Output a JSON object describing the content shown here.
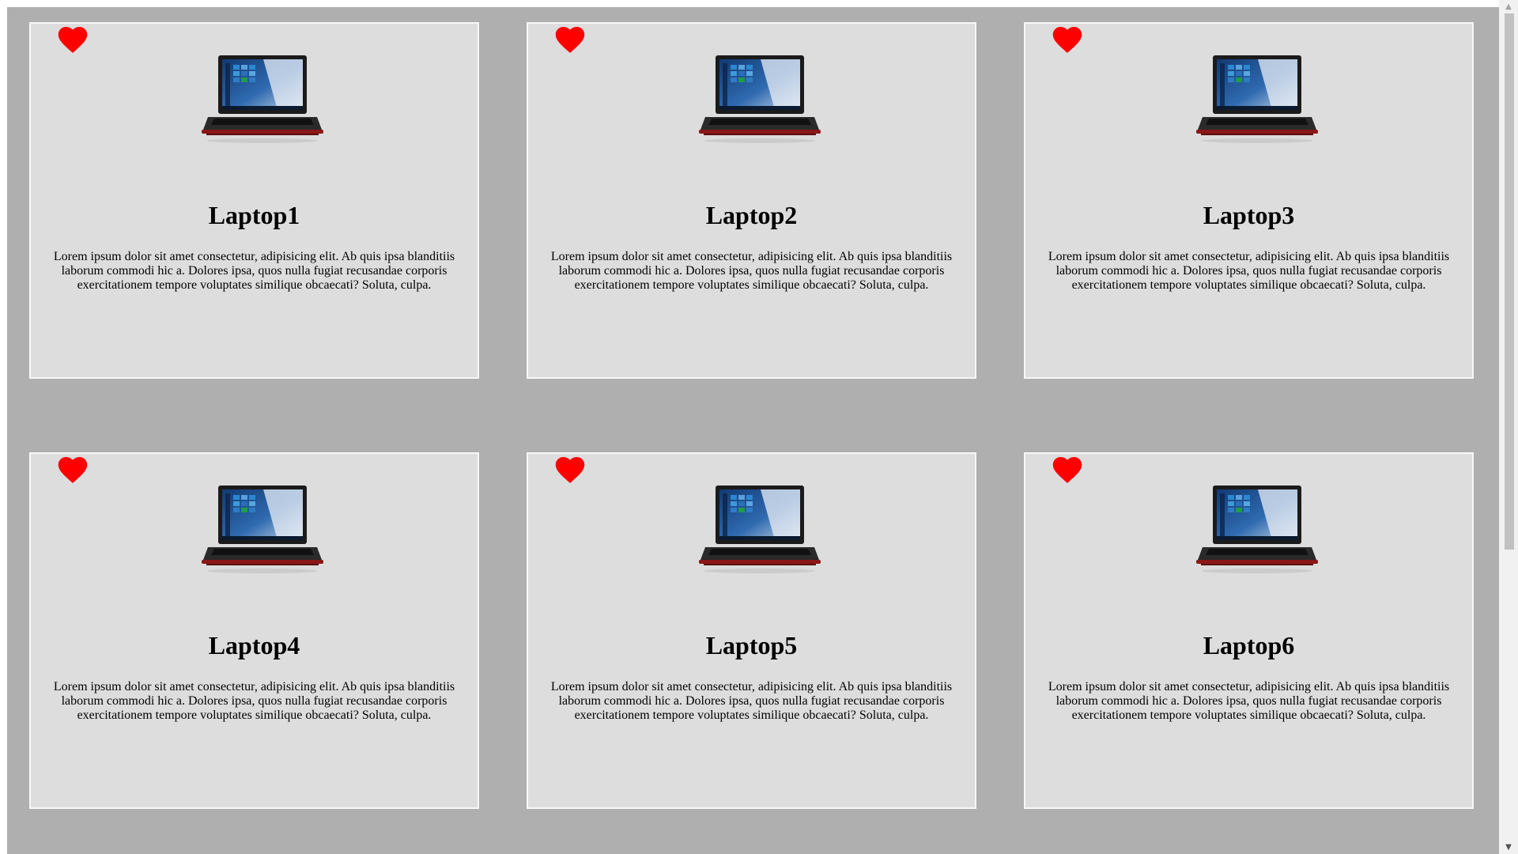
{
  "cards": [
    {
      "title": "Laptop1",
      "description": "Lorem ipsum dolor sit amet consectetur, adipisicing elit. Ab quis ipsa blanditiis laborum commodi hic a. Dolores ipsa, quos nulla fugiat recusandae corporis exercitationem tempore voluptates similique obcaecati? Soluta, culpa.",
      "favorite_icon": "heart-icon",
      "image_icon": "laptop-image"
    },
    {
      "title": "Laptop2",
      "description": "Lorem ipsum dolor sit amet consectetur, adipisicing elit. Ab quis ipsa blanditiis laborum commodi hic a. Dolores ipsa, quos nulla fugiat recusandae corporis exercitationem tempore voluptates similique obcaecati? Soluta, culpa.",
      "favorite_icon": "heart-icon",
      "image_icon": "laptop-image"
    },
    {
      "title": "Laptop3",
      "description": "Lorem ipsum dolor sit amet consectetur, adipisicing elit. Ab quis ipsa blanditiis laborum commodi hic a. Dolores ipsa, quos nulla fugiat recusandae corporis exercitationem tempore voluptates similique obcaecati? Soluta, culpa.",
      "favorite_icon": "heart-icon",
      "image_icon": "laptop-image"
    },
    {
      "title": "Laptop4",
      "description": "Lorem ipsum dolor sit amet consectetur, adipisicing elit. Ab quis ipsa blanditiis laborum commodi hic a. Dolores ipsa, quos nulla fugiat recusandae corporis exercitationem tempore voluptates similique obcaecati? Soluta, culpa.",
      "favorite_icon": "heart-icon",
      "image_icon": "laptop-image"
    },
    {
      "title": "Laptop5",
      "description": "Lorem ipsum dolor sit amet consectetur, adipisicing elit. Ab quis ipsa blanditiis laborum commodi hic a. Dolores ipsa, quos nulla fugiat recusandae corporis exercitationem tempore voluptates similique obcaecati? Soluta, culpa.",
      "favorite_icon": "heart-icon",
      "image_icon": "laptop-image"
    },
    {
      "title": "Laptop6",
      "description": "Lorem ipsum dolor sit amet consectetur, adipisicing elit. Ab quis ipsa blanditiis laborum commodi hic a. Dolores ipsa, quos nulla fugiat recusandae corporis exercitationem tempore voluptates similique obcaecati? Soluta, culpa.",
      "favorite_icon": "heart-icon",
      "image_icon": "laptop-image"
    }
  ],
  "colors": {
    "page_background": "#afafaf",
    "card_background": "#dddddd",
    "card_border": "#f7f7f7",
    "heart": "#ff0000"
  },
  "scrollbar": {
    "up_icon": "scroll-up-arrow-icon",
    "down_icon": "scroll-down-arrow-icon"
  }
}
